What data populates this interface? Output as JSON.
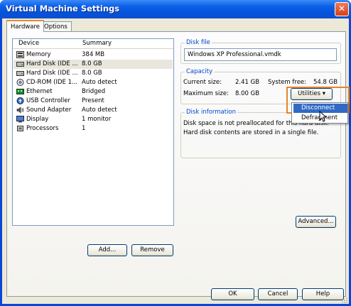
{
  "window": {
    "title": "Virtual Machine Settings",
    "close_glyph": "✕"
  },
  "tabs": [
    {
      "label": "Hardware",
      "active": true
    },
    {
      "label": "Options",
      "active": false
    }
  ],
  "device_list": {
    "columns": [
      "Device",
      "Summary"
    ],
    "rows": [
      {
        "icon": "memory-icon",
        "device": "Memory",
        "summary": "384 MB"
      },
      {
        "icon": "hard-disk-icon",
        "device": "Hard Disk (IDE ...",
        "summary": "8.0 GB",
        "selected": true
      },
      {
        "icon": "hard-disk-icon",
        "device": "Hard Disk (IDE ...",
        "summary": "8.0 GB"
      },
      {
        "icon": "cd-rom-icon",
        "device": "CD-ROM (IDE 1...",
        "summary": "Auto detect"
      },
      {
        "icon": "ethernet-icon",
        "device": "Ethernet",
        "summary": "Bridged"
      },
      {
        "icon": "usb-icon",
        "device": "USB Controller",
        "summary": "Present"
      },
      {
        "icon": "sound-icon",
        "device": "Sound Adapter",
        "summary": "Auto detect"
      },
      {
        "icon": "display-icon",
        "device": "Display",
        "summary": "1 monitor"
      },
      {
        "icon": "processor-icon",
        "device": "Processors",
        "summary": "1"
      }
    ]
  },
  "list_buttons": {
    "add": "Add...",
    "remove": "Remove"
  },
  "disk_file": {
    "title": "Disk file",
    "value": "Windows XP Professional.vmdk"
  },
  "capacity": {
    "title": "Capacity",
    "current_label": "Current size:",
    "current_value": "2.41 GB",
    "free_label": "System free:",
    "free_value": "54.8 GB",
    "max_label": "Maximum size:",
    "max_value": "8.00 GB",
    "utilities": "Utilities",
    "dropdown_arrow": "▾"
  },
  "utilities_menu": {
    "items": [
      "Disconnect",
      "Defragment"
    ],
    "highlighted": "Disconnect"
  },
  "disk_info": {
    "title": "Disk information",
    "line1": "Disk space is not preallocated for this hard disk.",
    "line2": "Hard disk contents are stored in a single file."
  },
  "advanced_button": "Advanced...",
  "footer": {
    "ok": "OK",
    "cancel": "Cancel",
    "help": "Help"
  },
  "colors": {
    "title_bar": "#0a5fe8",
    "group_title": "#0046d5",
    "menu_highlight": "#316ac5",
    "annotation_outline": "#e9832b"
  }
}
